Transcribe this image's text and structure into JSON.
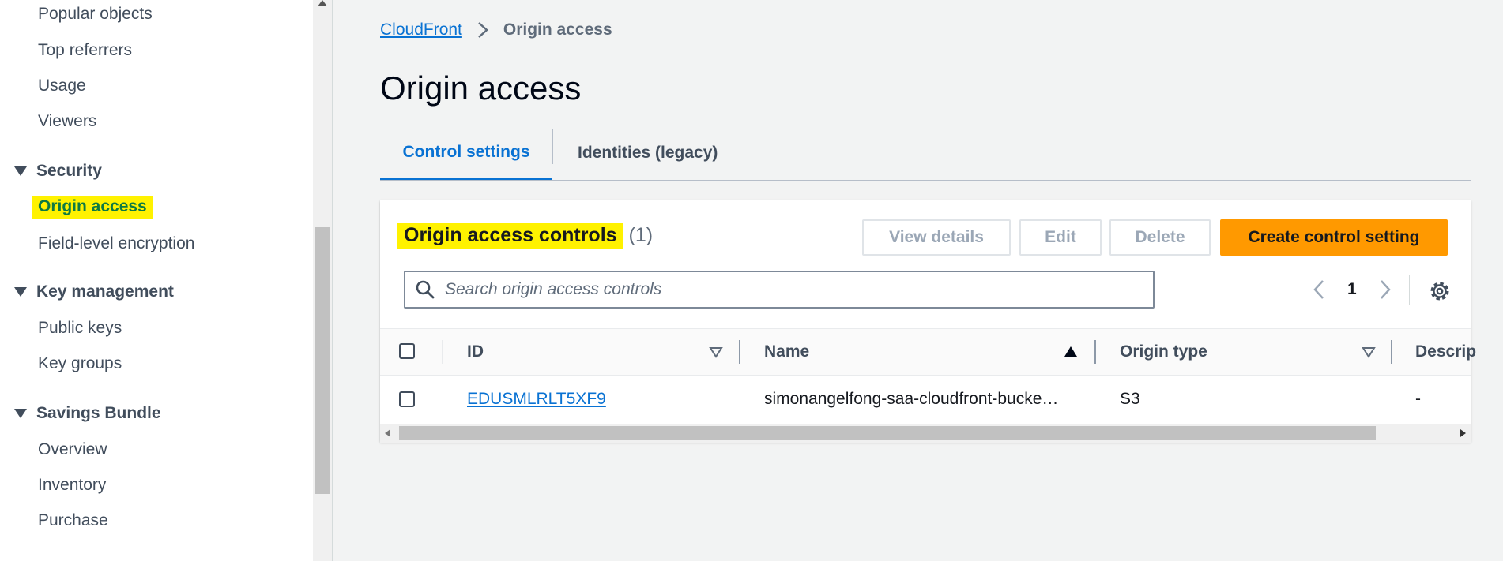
{
  "sidebar": {
    "items_top": [
      "Popular objects",
      "Top referrers",
      "Usage",
      "Viewers"
    ],
    "security": {
      "label": "Security",
      "items": [
        "Origin access",
        "Field-level encryption"
      ]
    },
    "key_management": {
      "label": "Key management",
      "items": [
        "Public keys",
        "Key groups"
      ]
    },
    "savings_bundle": {
      "label": "Savings Bundle",
      "items": [
        "Overview",
        "Inventory",
        "Purchase"
      ]
    },
    "highlight_color": "#fff200",
    "active_color": "#0d7a43"
  },
  "breadcrumb": {
    "root": "CloudFront",
    "current": "Origin access"
  },
  "page_title": "Origin access",
  "tabs": {
    "active": "Control settings",
    "other": "Identities (legacy)"
  },
  "panel": {
    "title": "Origin access controls",
    "count": "(1)",
    "buttons": {
      "view_details": "View details",
      "edit": "Edit",
      "delete": "Delete",
      "create": "Create control setting"
    },
    "search_placeholder": "Search origin access controls",
    "page_number": "1"
  },
  "table": {
    "columns": [
      "ID",
      "Name",
      "Origin type",
      "Descrip"
    ],
    "rows": [
      {
        "id": "EDUSMLRLT5XF9",
        "name": "simonangelfong-saa-cloudfront-bucke…",
        "origin_type": "S3",
        "description": "-"
      }
    ]
  },
  "colors": {
    "primary_button": "#ff9900",
    "link": "#0972d3"
  }
}
